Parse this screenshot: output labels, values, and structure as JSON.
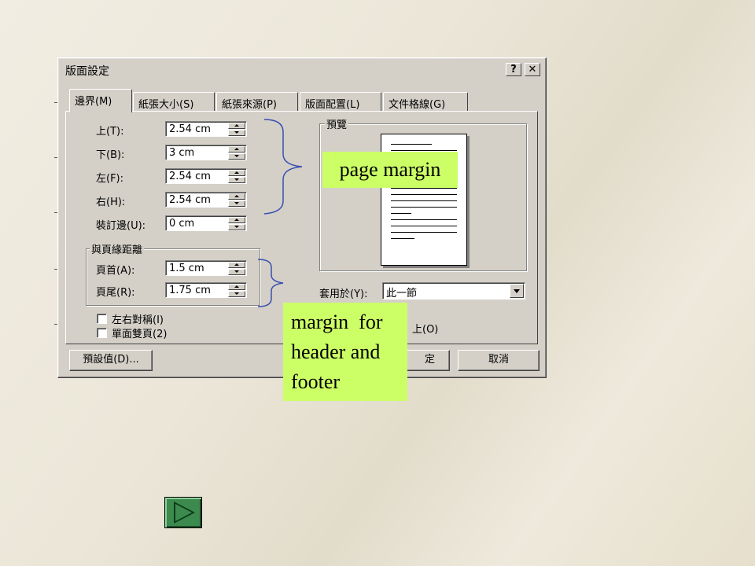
{
  "dialog": {
    "title": "版面設定",
    "help_button": "?",
    "close_button": "✕",
    "tabs": [
      {
        "label": "邊界(M)",
        "active": true
      },
      {
        "label": "紙張大小(S)",
        "active": false
      },
      {
        "label": "紙張來源(P)",
        "active": false
      },
      {
        "label": "版面配置(L)",
        "active": false
      },
      {
        "label": "文件格線(G)",
        "active": false
      }
    ],
    "margins": [
      {
        "label": "上(T):",
        "value": "2.54 cm"
      },
      {
        "label": "下(B):",
        "value": "3 cm"
      },
      {
        "label": "左(F):",
        "value": "2.54 cm"
      },
      {
        "label": "右(H):",
        "value": "2.54 cm"
      },
      {
        "label": "裝訂邊(U):",
        "value": "0 cm"
      }
    ],
    "header_footer_group": {
      "title": "與頁緣距離",
      "header": {
        "label": "頁首(A):",
        "value": "1.5 cm"
      },
      "footer": {
        "label": "頁尾(R):",
        "value": "1.75 cm"
      }
    },
    "checkboxes": [
      {
        "label": "左右對稱(I)",
        "checked": false
      },
      {
        "label": "單面雙頁(2)",
        "checked": false
      }
    ],
    "preview": {
      "title": "預覽",
      "apply_label": "套用於(Y):",
      "apply_value": "此一節",
      "gutter_partial": "上(O)"
    },
    "buttons": {
      "default": "預設值(D)...",
      "ok_partial": "定",
      "cancel": "取消"
    }
  },
  "annotations": {
    "page_margin": "page margin",
    "header_footer_lines": [
      "margin  for",
      "header and",
      "footer"
    ]
  },
  "colors": {
    "dialog_face": "#d4d0c8",
    "note_background": "#ccff66",
    "bracket": "#3a4fb0",
    "nav_button": "#3c8a4e"
  },
  "icons": {
    "nav": "play-triangle-icon"
  }
}
